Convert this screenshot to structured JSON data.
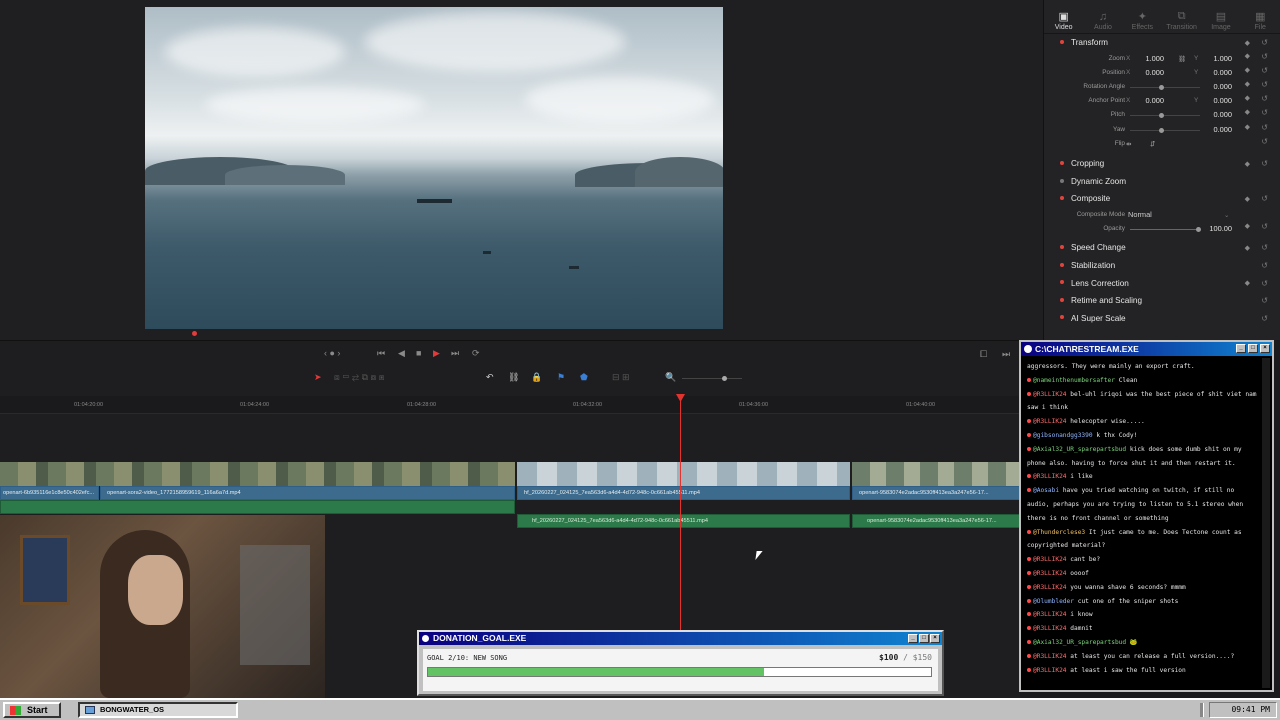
{
  "inspector": {
    "tabs": [
      {
        "label": "Video",
        "glyph": "▣",
        "active": true
      },
      {
        "label": "Audio",
        "glyph": "♫",
        "active": false
      },
      {
        "label": "Effects",
        "glyph": "✦",
        "active": false
      },
      {
        "label": "Transition",
        "glyph": "⧉",
        "active": false
      },
      {
        "label": "Image",
        "glyph": "▤",
        "active": false
      },
      {
        "label": "File",
        "glyph": "▦",
        "active": false
      }
    ],
    "transform": {
      "title": "Transform",
      "zoom_label": "Zoom",
      "zoom_x": "1.000",
      "zoom_y": "1.000",
      "position_label": "Position",
      "position_x": "0.000",
      "position_y": "0.000",
      "rotation_label": "Rotation Angle",
      "rotation": "0.000",
      "anchor_label": "Anchor Point",
      "anchor_x": "0.000",
      "anchor_y": "0.000",
      "pitch_label": "Pitch",
      "pitch": "0.000",
      "yaw_label": "Yaw",
      "yaw": "0.000",
      "flip_label": "Flip",
      "x": "X",
      "y": "Y"
    },
    "cropping": "Cropping",
    "dynamic_zoom": "Dynamic Zoom",
    "composite": {
      "title": "Composite",
      "mode_label": "Composite Mode",
      "mode_value": "Normal",
      "opacity_label": "Opacity",
      "opacity_value": "100.00"
    },
    "speed_change": "Speed Change",
    "stabilization": "Stabilization",
    "lens_correction": "Lens Correction",
    "retime": "Retime and Scaling",
    "super_scale": "AI Super Scale"
  },
  "timeline": {
    "timecodes": [
      "01:04:20:00",
      "01:04:24:00",
      "01:04:28:00",
      "01:04:32:00",
      "01:04:36:00",
      "01:04:40:00"
    ],
    "video_clips": [
      {
        "label": "openart-6b935116e1c8e50c402efc..."
      },
      {
        "label": "openart-sora2-video_1772158959619_116a6a7d.mp4"
      },
      {
        "label": "hf_20260227_024125_7ea563d6-a4d4-4d72-948c-0c661ab45511.mp4"
      },
      {
        "label": "openart-9583074e2adac9530ff413ea3a247e56-17..."
      }
    ],
    "audio_clips": [
      {
        "label": "hf_20260227_024125_7ea563d6-a4d4-4d72-948c-0c661ab45511.mp4"
      },
      {
        "label": "openart-9583074e2adac9530ff413ea3a247e56-17..."
      }
    ]
  },
  "chat": {
    "title": "C:\\CHAT\\RESTREAM.EXE",
    "messages": [
      {
        "user": "",
        "text": "aggressors. They were mainly an export craft.",
        "cls": ""
      },
      {
        "user": "@nameinthenumbersafter",
        "text": "Clean",
        "cls": "c2"
      },
      {
        "user": "@R3LLIK24",
        "text": "bel-uhl iriqoi was the best piece of shit viet nam saw i think",
        "cls": ""
      },
      {
        "user": "@R3LLIK24",
        "text": "helecopter wise.....",
        "cls": ""
      },
      {
        "user": "@gibsonandgg3390",
        "text": "k thx Cody!",
        "cls": "c3"
      },
      {
        "user": "@Axial32_UR_sparepartsbud",
        "text": "kick does some dumb shit on my phone also. having to force shut it and then restart it.",
        "cls": "c2"
      },
      {
        "user": "@R3LLIK24",
        "text": "i like",
        "cls": ""
      },
      {
        "user": "@Aosabi",
        "text": "have you tried watching on twitch, if still no audio, perhaps you are trying to listen to 5.1 stereo when there is no front channel or something",
        "cls": "c3"
      },
      {
        "user": "@Thunderclese3",
        "text": "It just came to me. Does Tectone count as copyrighted material?",
        "cls": "c4"
      },
      {
        "user": "@R3LLIK24",
        "text": "cant be?",
        "cls": ""
      },
      {
        "user": "@R3LLIK24",
        "text": "oooof",
        "cls": ""
      },
      {
        "user": "@R3LLIK24",
        "text": "you wanna shave 6 seconds? mmmm",
        "cls": ""
      },
      {
        "user": "@Olumbleder",
        "text": "cut one of the sniper shots",
        "cls": "c3"
      },
      {
        "user": "@R3LLIK24",
        "text": "i know",
        "cls": ""
      },
      {
        "user": "@R3LLIK24",
        "text": "damnit",
        "cls": ""
      },
      {
        "user": "@Axial32_UR_sparepartsbud",
        "text": "🐸",
        "cls": "c2"
      },
      {
        "user": "@R3LLIK24",
        "text": "at least you can release a full version....?",
        "cls": ""
      },
      {
        "user": "@R3LLIK24",
        "text": "at least i saw the full version",
        "cls": ""
      }
    ]
  },
  "donation": {
    "title": "DONATION_GOAL.EXE",
    "goal": "GOAL 2/10: NEW SONG",
    "current": "$100",
    "total": " / $150",
    "progress": 0.667
  },
  "taskbar": {
    "start": "Start",
    "task": "BONGWATER_OS",
    "clock": "09:41 PM"
  }
}
